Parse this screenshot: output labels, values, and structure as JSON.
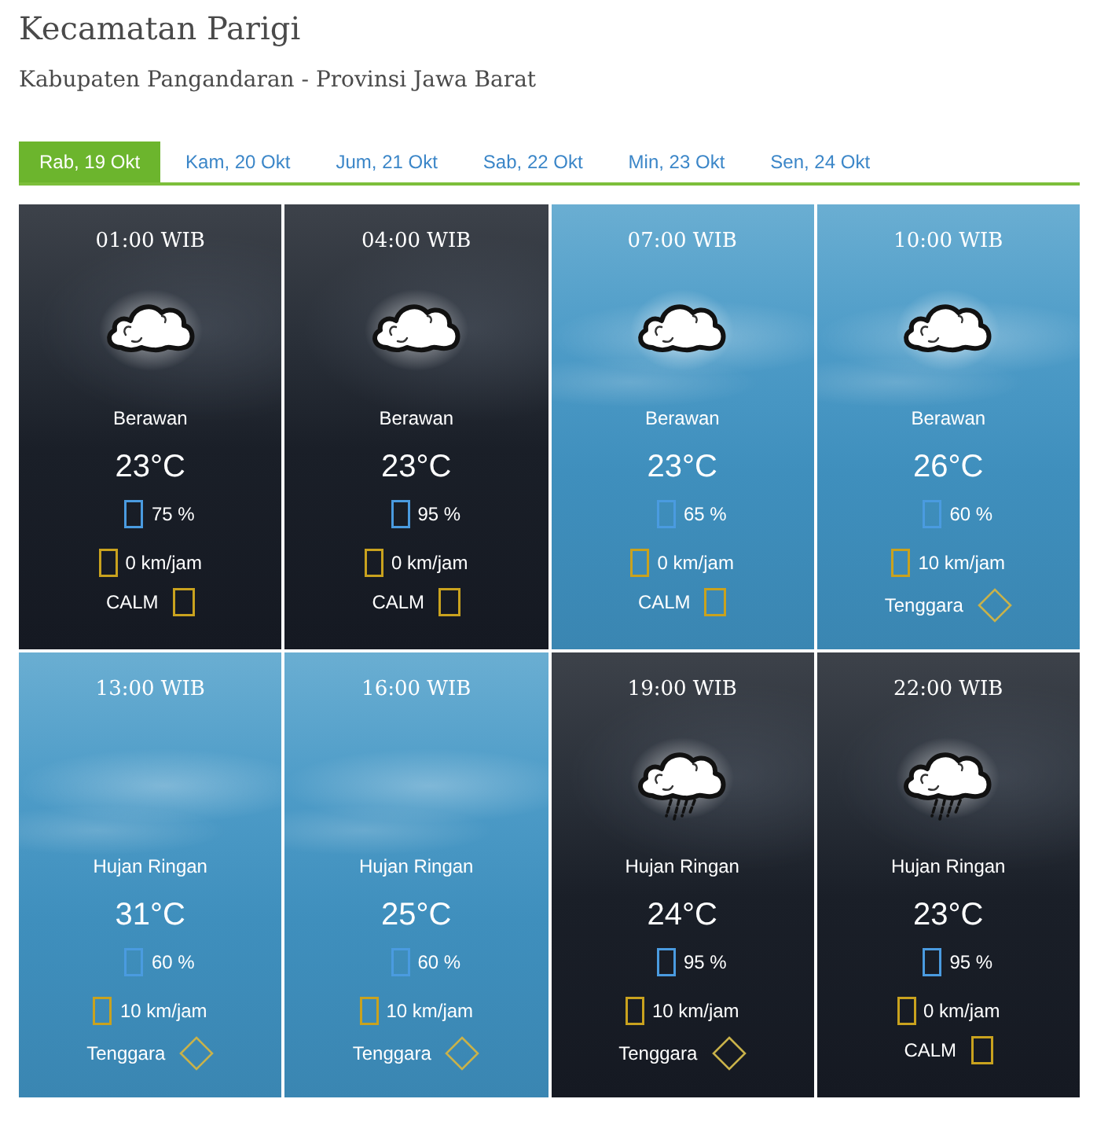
{
  "header": {
    "title": "Kecamatan Parigi",
    "subtitle": "Kabupaten Pangandaran - Provinsi Jawa Barat"
  },
  "tabs": [
    {
      "label": "Rab, 19 Okt",
      "selected": true
    },
    {
      "label": "Kam, 20 Okt",
      "selected": false
    },
    {
      "label": "Jum, 21 Okt",
      "selected": false
    },
    {
      "label": "Sab, 22 Okt",
      "selected": false
    },
    {
      "label": "Min, 23 Okt",
      "selected": false
    },
    {
      "label": "Sen, 24 Okt",
      "selected": false
    }
  ],
  "forecasts": [
    {
      "kind": "night",
      "time": "01:00 WIB",
      "weather_icon": {
        "kind": "cloud"
      },
      "condition": "Berawan",
      "temperature": "23°C",
      "humidity": "75 %",
      "wind_speed": "0 km/jam",
      "wind_direction": {
        "label": "CALM",
        "kind": "square"
      }
    },
    {
      "kind": "night",
      "time": "04:00 WIB",
      "weather_icon": {
        "kind": "cloud"
      },
      "condition": "Berawan",
      "temperature": "23°C",
      "humidity": "95 %",
      "wind_speed": "0 km/jam",
      "wind_direction": {
        "label": "CALM",
        "kind": "square"
      }
    },
    {
      "kind": "day",
      "time": "07:00 WIB",
      "weather_icon": {
        "kind": "cloud"
      },
      "condition": "Berawan",
      "temperature": "23°C",
      "humidity": "65 %",
      "wind_speed": "0 km/jam",
      "wind_direction": {
        "label": "CALM",
        "kind": "square"
      }
    },
    {
      "kind": "day",
      "time": "10:00 WIB",
      "weather_icon": {
        "kind": "cloud"
      },
      "condition": "Berawan",
      "temperature": "26°C",
      "humidity": "60 %",
      "wind_speed": "10 km/jam",
      "wind_direction": {
        "label": "Tenggara",
        "kind": "diamond"
      }
    },
    {
      "kind": "day",
      "time": "13:00 WIB",
      "condition": "Hujan Ringan",
      "temperature": "31°C",
      "humidity": "60 %",
      "wind_speed": "10 km/jam",
      "wind_direction": {
        "label": "Tenggara",
        "kind": "diamond"
      }
    },
    {
      "kind": "day",
      "time": "16:00 WIB",
      "condition": "Hujan Ringan",
      "temperature": "25°C",
      "humidity": "60 %",
      "wind_speed": "10 km/jam",
      "wind_direction": {
        "label": "Tenggara",
        "kind": "diamond"
      }
    },
    {
      "kind": "night",
      "time": "19:00 WIB",
      "weather_icon": {
        "kind": "rain"
      },
      "condition": "Hujan Ringan",
      "temperature": "24°C",
      "humidity": "95 %",
      "wind_speed": "10 km/jam",
      "wind_direction": {
        "label": "Tenggara",
        "kind": "diamond"
      }
    },
    {
      "kind": "night",
      "time": "22:00 WIB",
      "weather_icon": {
        "kind": "rain"
      },
      "condition": "Hujan Ringan",
      "temperature": "23°C",
      "humidity": "95 %",
      "wind_speed": "0 km/jam",
      "wind_direction": {
        "label": "CALM",
        "kind": "square"
      }
    }
  ]
}
